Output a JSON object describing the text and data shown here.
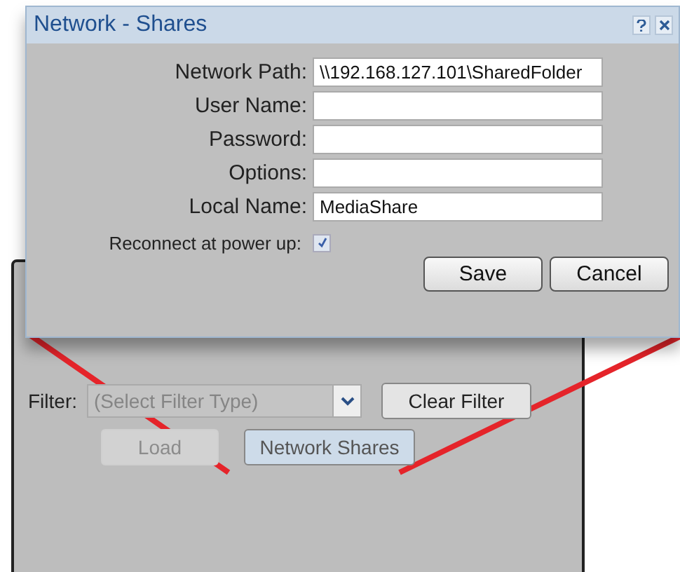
{
  "dialog": {
    "title": "Network - Shares",
    "fields": [
      {
        "label": "Network Path:",
        "value": "\\\\192.168.127.101\\SharedFolder"
      },
      {
        "label": "User Name:"
      },
      {
        "label": "Password:"
      },
      {
        "label": "Options:"
      },
      {
        "label": "Local Name:",
        "value": "MediaShare"
      }
    ],
    "reconnect": {
      "label": "Reconnect at power up:",
      "checked": true
    },
    "buttons": [
      "Save",
      "Cancel"
    ]
  },
  "panel": {
    "filter": {
      "label": "Filter:",
      "placeholder": "(Select Filter Type)",
      "disabled": true
    },
    "buttons": [
      {
        "label": "Clear Filter",
        "disabled": false,
        "selected": false
      },
      {
        "label": "Load",
        "disabled": true,
        "selected": false
      },
      {
        "label": "Network Shares",
        "disabled": false,
        "selected": true
      }
    ]
  }
}
